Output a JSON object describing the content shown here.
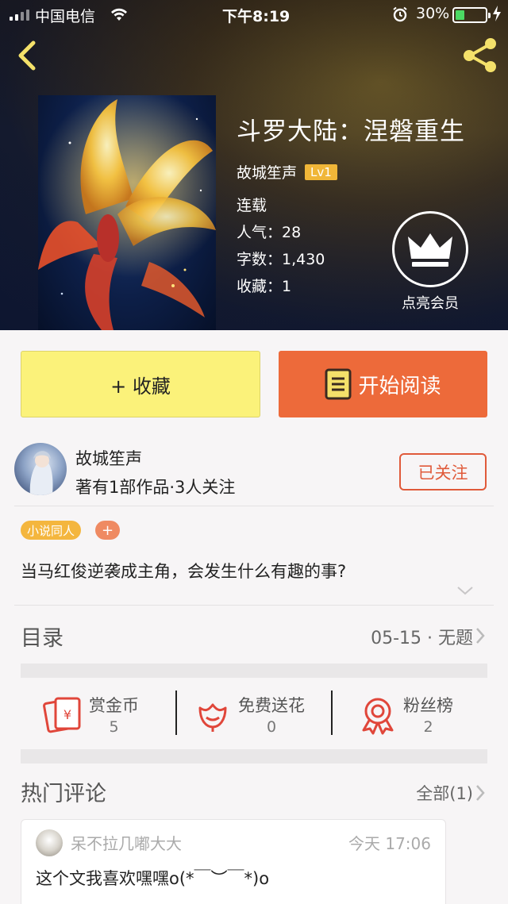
{
  "status_bar": {
    "carrier": "中国电信",
    "time": "下午8:19",
    "battery_percent": "30%",
    "battery_level": 0.3
  },
  "book": {
    "title": "斗罗大陆：涅磐重生",
    "author": "故城笙声",
    "level": "Lv1",
    "status": "连载",
    "popularity": "人气：28",
    "word_count": "字数：1,430",
    "favorites": "收藏：1"
  },
  "vip": {
    "label": "点亮会员"
  },
  "actions": {
    "collect": "+ 收藏",
    "read": "开始阅读"
  },
  "author_block": {
    "name": "故城笙声",
    "stats": "著有1部作品·3人关注",
    "follow": "已关注"
  },
  "tags": {
    "category": "小说同人",
    "add": "+"
  },
  "description": "当马红俊逆袭成主角，会发生什么有趣的事?",
  "catalog": {
    "title": "目录",
    "latest": "05-15 · 无题"
  },
  "stats": [
    {
      "label": "赏金币",
      "value": "5",
      "icon": "red-envelope-icon"
    },
    {
      "label": "免费送花",
      "value": "0",
      "icon": "flower-icon"
    },
    {
      "label": "粉丝榜",
      "value": "2",
      "icon": "medal-icon"
    }
  ],
  "comments": {
    "title": "热门评论",
    "all": "全部(1)",
    "items": [
      {
        "user": "呆不拉几嘟大大",
        "time": "今天 17:06",
        "text": "这个文我喜欢嘿嘿o(*￣︶￣*)o"
      }
    ]
  },
  "colors": {
    "accent_orange": "#ed6a3a",
    "collect_yellow": "#fbf27a",
    "icon_red": "#e0463a",
    "tag_yellow": "#f4b63e",
    "level_badge": "#f0b638"
  }
}
